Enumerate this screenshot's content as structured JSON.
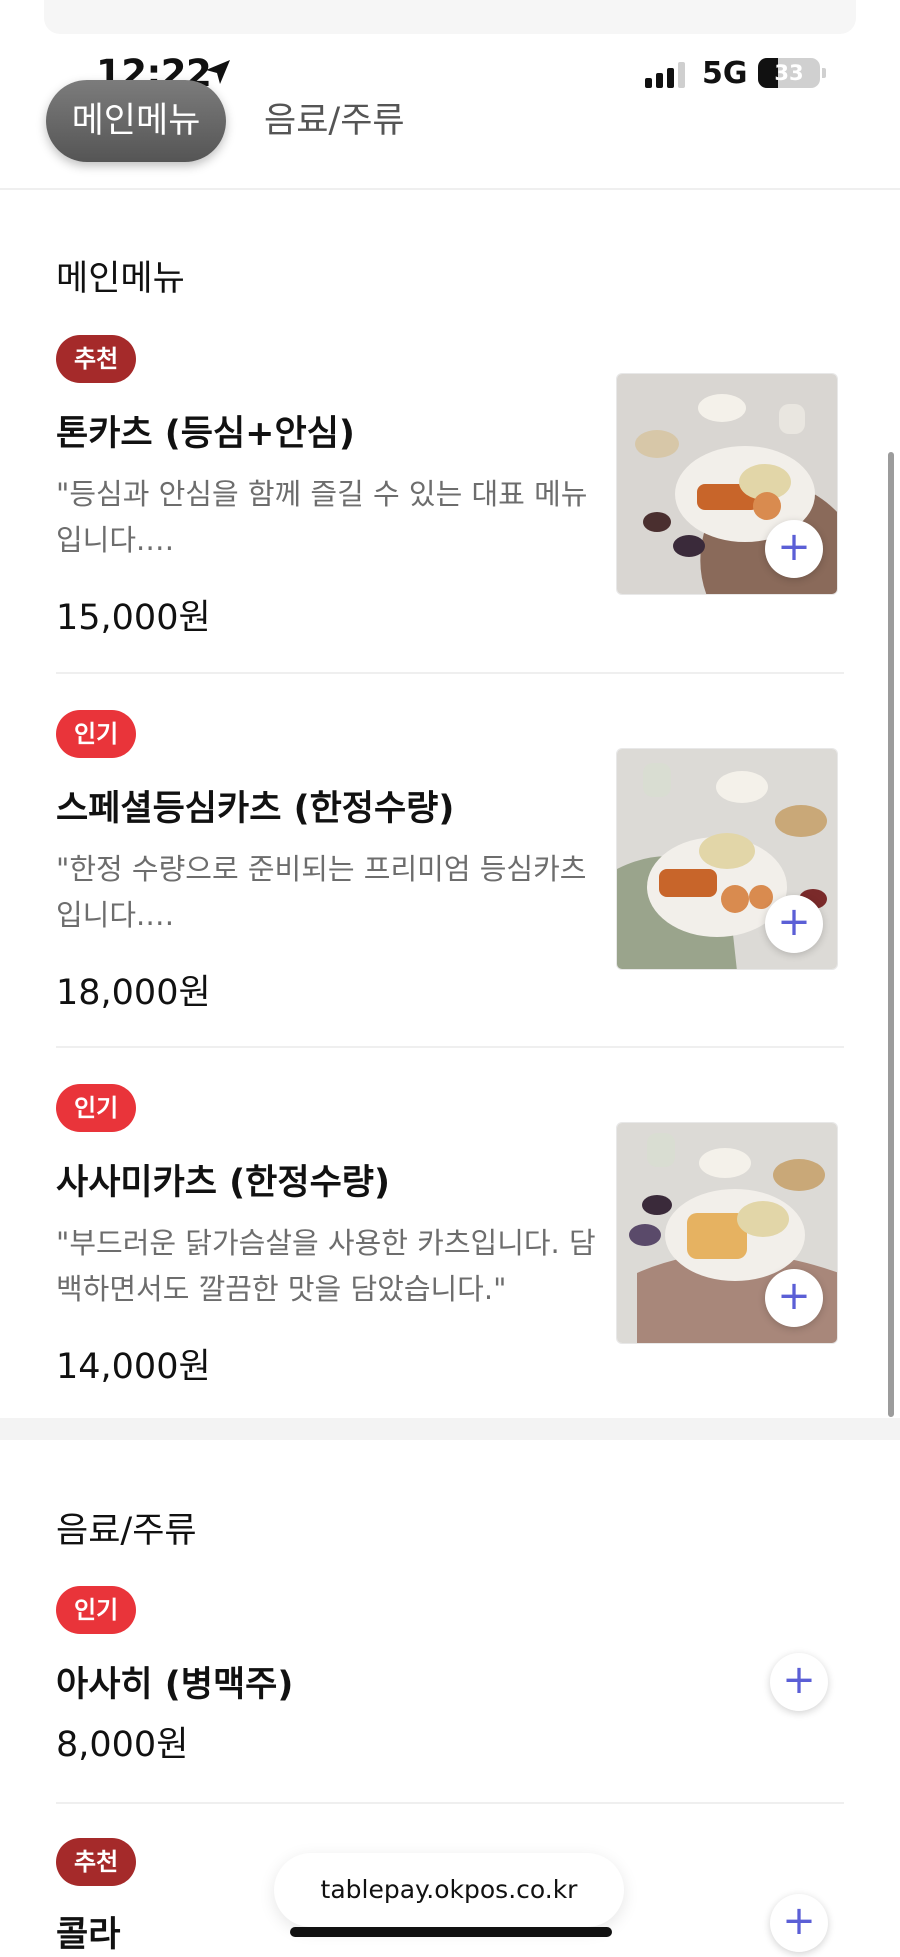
{
  "status_bar": {
    "time": "12:22",
    "network": "5G",
    "battery_level": "33",
    "battery_fraction": 0.33,
    "icons": [
      "location-arrow-icon",
      "signal-bars-icon",
      "battery-icon"
    ]
  },
  "tabs": [
    {
      "label": "메인메뉴",
      "active": true
    },
    {
      "label": "음료/주류",
      "active": false
    }
  ],
  "sections": {
    "main": {
      "title": "메인메뉴",
      "items": [
        {
          "badge": "추천",
          "name": "톤카츠 (등심+안심)",
          "desc": "\"등심과 안심을 함께 즐길 수 있는 대표 메뉴입니다.…",
          "price": "15,000원",
          "add_label": "+"
        },
        {
          "badge": "인기",
          "name": "스페셜등심카츠 (한정수량)",
          "desc": "\"한정 수량으로 준비되는 프리미엄 등심카츠입니다.…",
          "price": "18,000원",
          "add_label": "+"
        },
        {
          "badge": "인기",
          "name": "사사미카츠 (한정수량)",
          "desc": "\"부드러운 닭가슴살을 사용한 카츠입니다. 담백하면서도 깔끔한 맛을 담았습니다.\"",
          "price": "14,000원",
          "add_label": "+"
        }
      ]
    },
    "drinks": {
      "title": "음료/주류",
      "items": [
        {
          "badge": "인기",
          "name": "아사히 (병맥주)",
          "price": "8,000원",
          "add_label": "+"
        },
        {
          "badge": "추천",
          "name": "콜라",
          "add_label": "+"
        }
      ]
    }
  },
  "browser": {
    "url": "tablepay.okpos.co.kr"
  },
  "colors": {
    "badge_recommend": "#a52a2a",
    "badge_popular": "#e9343a",
    "accent_plus": "#5b5fd6"
  }
}
